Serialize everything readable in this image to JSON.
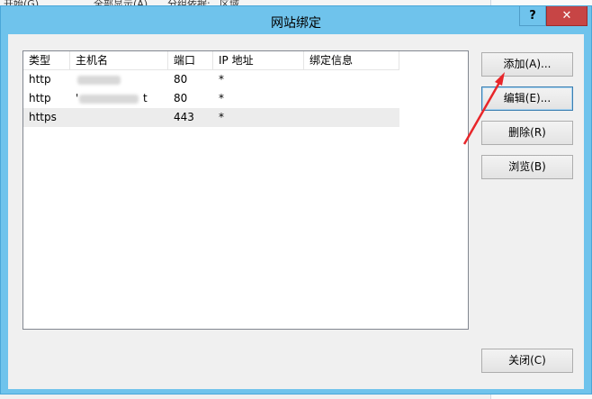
{
  "background": {
    "toolbar": {
      "start_label": "开始(G)",
      "show_all_label": "全部显示(A)",
      "group_by_label": "分组依据:",
      "group_value": "区域"
    }
  },
  "dialog": {
    "title": "网站绑定",
    "help_glyph": "?",
    "close_glyph": "✕"
  },
  "bindings_list": {
    "columns": [
      "类型",
      "主机名",
      "端口",
      "IP 地址",
      "绑定信息"
    ],
    "rows": [
      {
        "type": "http",
        "host": "",
        "port": "80",
        "ip": "*",
        "info": ""
      },
      {
        "type": "http",
        "host": "'",
        "host_suffix": "t",
        "port": "80",
        "ip": "*",
        "info": ""
      },
      {
        "type": "https",
        "host": "",
        "port": "443",
        "ip": "*",
        "info": ""
      }
    ]
  },
  "buttons": {
    "add": "添加(A)...",
    "edit": "编辑(E)...",
    "remove": "删除(R)",
    "browse": "浏览(B)",
    "close": "关闭(C)"
  },
  "colors": {
    "title_bar": "#6fc3ec",
    "close_button": "#c74545",
    "arrow": "#e8262a"
  }
}
